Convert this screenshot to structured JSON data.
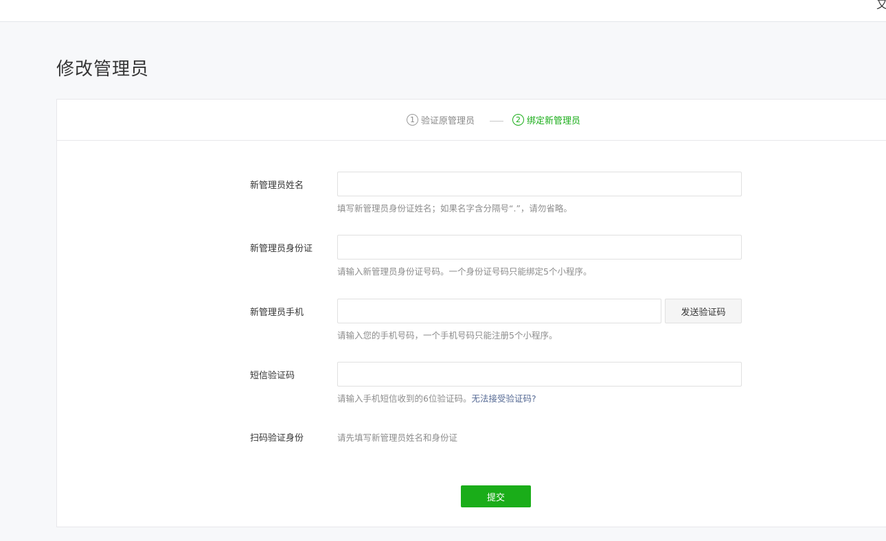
{
  "topbar": {
    "corner_glyph": "又"
  },
  "page": {
    "title": "修改管理员"
  },
  "steps": [
    {
      "num": "1",
      "label": "验证原管理员"
    },
    {
      "num": "2",
      "label": "绑定新管理员"
    }
  ],
  "form": {
    "name": {
      "label": "新管理员姓名",
      "value": "",
      "hint": "填写新管理员身份证姓名；如果名字含分隔号“.”，请勿省略。"
    },
    "id_card": {
      "label": "新管理员身份证",
      "value": "",
      "hint": "请输入新管理员身份证号码。一个身份证号码只能绑定5个小程序。"
    },
    "phone": {
      "label": "新管理员手机",
      "value": "",
      "send_button": "发送验证码",
      "hint": "请输入您的手机号码，一个手机号码只能注册5个小程序。"
    },
    "sms_code": {
      "label": "短信验证码",
      "value": "",
      "hint": "请输入手机短信收到的6位验证码。",
      "hint_link": "无法接受验证码?"
    },
    "scan": {
      "label": "扫码验证身份",
      "hint": "请先填写新管理员姓名和身份证"
    },
    "submit": "提交"
  },
  "colors": {
    "accent": "#1aad19",
    "link": "#576b95"
  }
}
